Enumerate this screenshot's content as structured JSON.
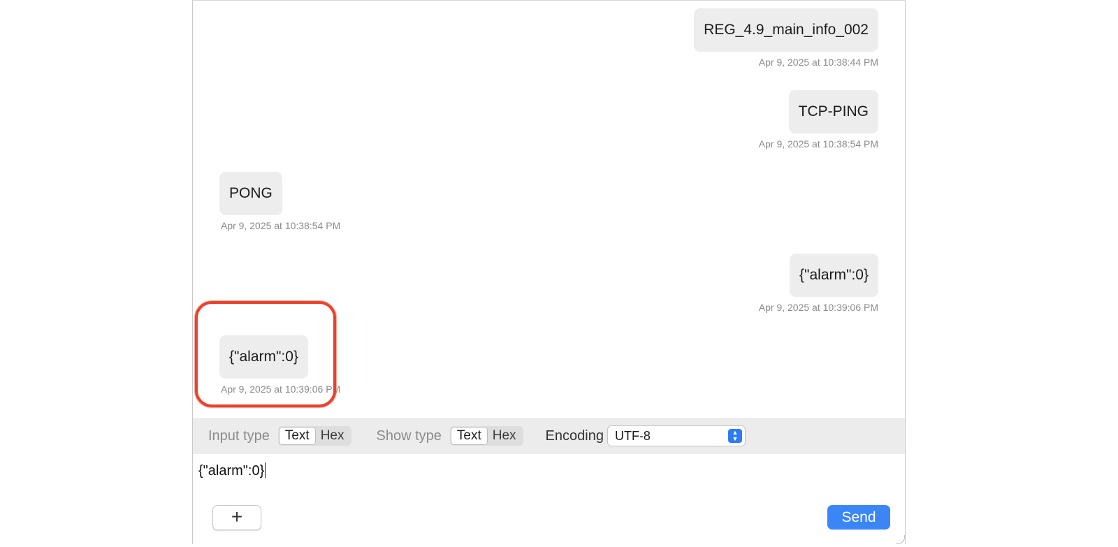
{
  "messages": [
    {
      "direction": "sent",
      "text": "REG_4.9_main_info_002",
      "time": "Apr 9, 2025 at 10:38:44 PM"
    },
    {
      "direction": "sent",
      "text": "TCP-PING",
      "time": "Apr 9, 2025 at 10:38:54 PM"
    },
    {
      "direction": "received",
      "text": "PONG",
      "time": "Apr 9, 2025 at 10:38:54 PM"
    },
    {
      "direction": "sent",
      "text": "{\"alarm\":0}",
      "time": "Apr 9, 2025 at 10:39:06 PM"
    },
    {
      "direction": "received",
      "text": "{\"alarm\":0}",
      "time": "Apr 9, 2025 at 10:39:06 PM",
      "highlighted": true
    }
  ],
  "toolbar": {
    "input_type_label": "Input type",
    "input_type_options": [
      "Text",
      "Hex"
    ],
    "input_type_selected": "Text",
    "show_type_label": "Show type",
    "show_type_options": [
      "Text",
      "Hex"
    ],
    "show_type_selected": "Text",
    "encoding_label": "Encoding",
    "encoding_value": "UTF-8"
  },
  "input": {
    "value": "{\"alarm\":0}"
  },
  "buttons": {
    "add_icon": "plus-icon",
    "add_glyph": "+",
    "send_label": "Send"
  },
  "colors": {
    "accent": "#3b86f6",
    "highlight": "#e8432b",
    "bubble": "#ededed"
  }
}
